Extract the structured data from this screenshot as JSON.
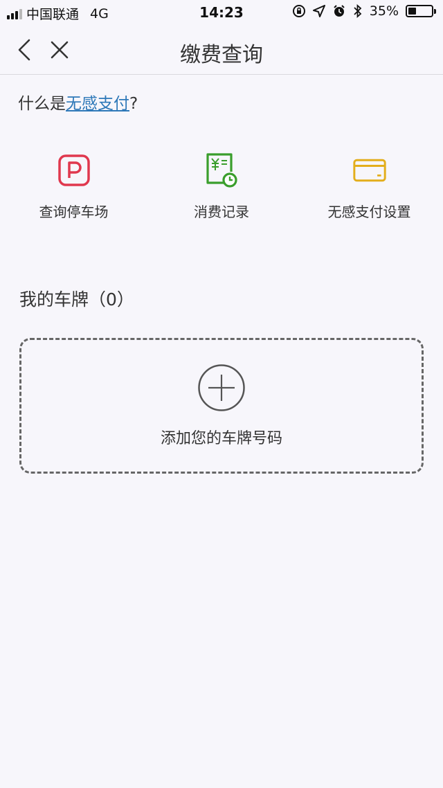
{
  "status_bar": {
    "carrier": "中国联通",
    "network": "4G",
    "time": "14:23",
    "battery_text": "35%",
    "battery_level": 0.35
  },
  "nav": {
    "title": "缴费查询",
    "back_icon": "chevron-left-icon",
    "close_icon": "close-icon"
  },
  "intro": {
    "prefix": "什么是",
    "link": "无感支付",
    "suffix": "?"
  },
  "actions": [
    {
      "label": "查询停车场",
      "icon": "parking-icon",
      "color": "#e0384e"
    },
    {
      "label": "消费记录",
      "icon": "receipt-clock-icon",
      "color": "#3a9e2c"
    },
    {
      "label": "无感支付设置",
      "icon": "card-icon",
      "color": "#e3ae1c"
    }
  ],
  "plates": {
    "title": "我的车牌（0）",
    "add_label": "添加您的车牌号码"
  },
  "colors": {
    "link": "#2d78b8",
    "background": "#f7f6fb"
  }
}
